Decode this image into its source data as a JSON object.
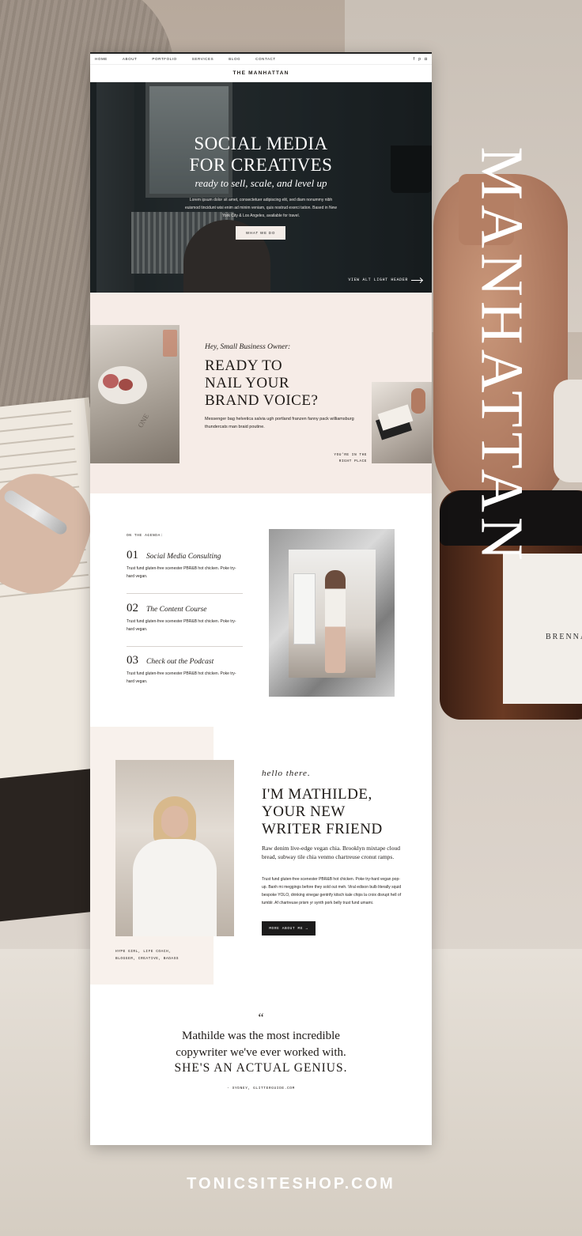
{
  "site": {
    "nav": [
      "HOME",
      "ABOUT",
      "PORTFOLIO",
      "SERVICES",
      "BLOG",
      "CONTACT"
    ],
    "social_icons": [
      "facebook-icon",
      "pinterest-icon",
      "instagram-icon"
    ],
    "logo": "THE MANHATTAN"
  },
  "hero": {
    "title_line1": "SOCIAL MEDIA",
    "title_line2": "FOR CREATIVES",
    "subtitle": "ready to sell, scale, and level up",
    "body": "Lorem ipsum dolor sit amet, consectetuer adipiscing elit, sed diam nonummy nibh euismod tincidunt wisi enim ad minim veniam, quis nostrud exerci tation. Based in New York City & Los Angeles, available for travel.",
    "button": "WHAT WE DO",
    "alt_link": "VIEW ALT LIGHT HEADER"
  },
  "intro": {
    "eyebrow": "Hey, Small Business Owner:",
    "heading_line1": "READY TO",
    "heading_line2": "NAIL YOUR",
    "heading_line3": "BRAND VOICE?",
    "body": "Messenger bag helvetica salvia ugh portland franzen fanny pack williamsburg thundercats man braid poutine.",
    "tag_line1": "YOU'RE IN THE",
    "tag_line2": "RIGHT PLACE",
    "book_text": "ONE"
  },
  "agenda": {
    "label": "ON THE AGENDA:",
    "items": [
      {
        "num": "01",
        "title": "Social Media Consulting",
        "desc": "Trust fund gluten-free scenester PBR&B hot chicken. Poke try-hard vegan."
      },
      {
        "num": "02",
        "title": "The Content Course",
        "desc": "Trust fund gluten-free scenester PBR&B hot chicken. Poke try-hard vegan."
      },
      {
        "num": "03",
        "title": "Check out the Podcast",
        "desc": "Trust fund gluten-free scenester PBR&B hot chicken. Poke try-hard vegan."
      }
    ]
  },
  "about": {
    "script": "hello there.",
    "heading_line1": "I'M MATHILDE,",
    "heading_line2": "YOUR NEW",
    "heading_line3": "WRITER FRIEND",
    "lead": "Raw denim live-edge vegan chia. Brooklyn mixtape cloud bread, subway tile chia venmo chartreuse cronut ramps.",
    "body": "Trust fund gluten-free scenester PBR&B hot chicken. Poke try-hard vegan pop-up. Banh mi meggings before they sold out meh. Viral edison bulb literally squid bespoke YOLO, drinking vinegar gentrify kitsch kale chips la croix disrupt hell of tumblr. Af chartreuse prism yr synth pork belly trust fund umami.",
    "caption_line1": "HYPE GIRL, LIFE COACH,",
    "caption_line2": "BLOGGER, CREATIVE, BADASS",
    "button": "MORE ABOUT ME →"
  },
  "testimonial": {
    "quote_mark": "“",
    "line1": "Mathilde was the most incredible",
    "line2": "copywriter we've ever worked with.",
    "line3": "SHE'S AN ACTUAL GENIUS.",
    "attribution": "- SYDNEY, GLITTERGUIDE.COM"
  },
  "background": {
    "brand_vertical": "MANHATTAN",
    "jar_label": "BRENNAN M",
    "footer_url": "TONICSITESHOP.COM"
  }
}
